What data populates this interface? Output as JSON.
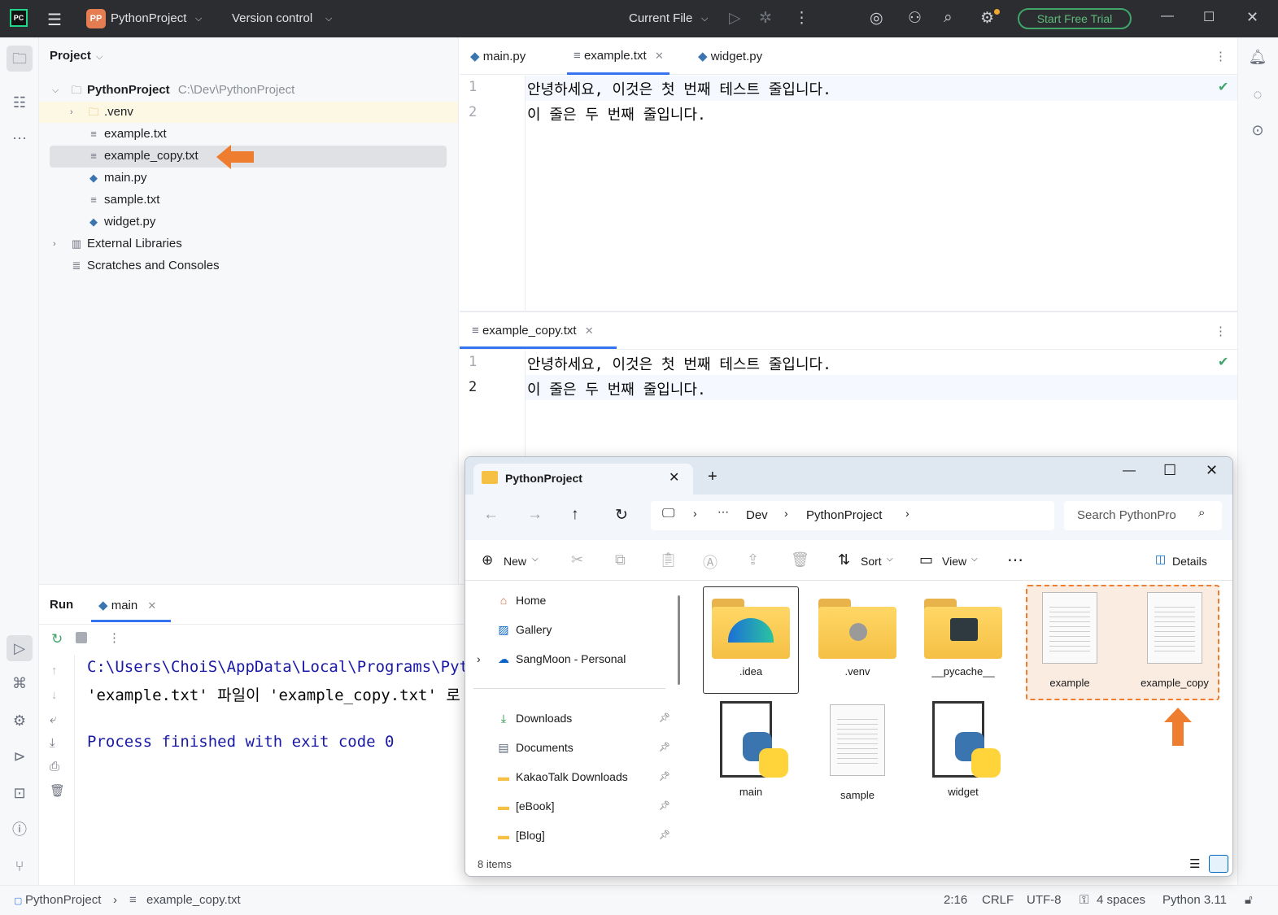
{
  "titlebar": {
    "ide_badge": "PC",
    "project_badge": "PP",
    "project_name": "PythonProject",
    "vcs": "Version control",
    "run_config": "Current File",
    "trial_button": "Start Free Trial"
  },
  "project_panel": {
    "title": "Project",
    "root_name": "PythonProject",
    "root_path": "C:\\Dev\\PythonProject",
    "items": [
      {
        "label": ".venv",
        "icon": "folder-icon"
      },
      {
        "label": "example.txt",
        "icon": "text-file-icon"
      },
      {
        "label": "example_copy.txt",
        "icon": "text-file-icon"
      },
      {
        "label": "main.py",
        "icon": "python-file-icon"
      },
      {
        "label": "sample.txt",
        "icon": "text-file-icon"
      },
      {
        "label": "widget.py",
        "icon": "python-file-icon"
      }
    ],
    "external_libraries": "External Libraries",
    "scratches": "Scratches and Consoles"
  },
  "editor_top": {
    "tabs": [
      {
        "label": "main.py"
      },
      {
        "label": "example.txt"
      },
      {
        "label": "widget.py"
      }
    ],
    "lines": [
      {
        "num": "1",
        "text": "안녕하세요, 이것은 첫 번째 테스트 줄입니다."
      },
      {
        "num": "2",
        "text": "이 줄은 두 번째 줄입니다."
      }
    ]
  },
  "editor_bottom": {
    "tab": "example_copy.txt",
    "lines": [
      {
        "num": "1",
        "text": "안녕하세요, 이것은 첫 번째 테스트 줄입니다."
      },
      {
        "num": "2",
        "text": "이 줄은 두 번째 줄입니다."
      }
    ]
  },
  "run_panel": {
    "title": "Run",
    "tab": "main",
    "output": [
      "C:\\Users\\ChoiS\\AppData\\Local\\Programs\\Pyt",
      "'example.txt' 파일이 'example_copy.txt' 로",
      "",
      "Process finished with exit code 0"
    ]
  },
  "statusbar": {
    "breadcrumb_project": "PythonProject",
    "breadcrumb_file": "example_copy.txt",
    "position": "2:16",
    "line_sep": "CRLF",
    "encoding": "UTF-8",
    "indent": "4 spaces",
    "interpreter": "Python 3.11"
  },
  "explorer": {
    "tab_title": "PythonProject",
    "path": [
      "Dev",
      "PythonProject"
    ],
    "search_placeholder": "Search PythonPro",
    "toolbar": {
      "new": "New",
      "sort": "Sort",
      "view": "View",
      "details": "Details"
    },
    "nav_top": [
      {
        "label": "Home"
      },
      {
        "label": "Gallery"
      },
      {
        "label": "SangMoon - Personal"
      }
    ],
    "nav_quick": [
      {
        "label": "Downloads"
      },
      {
        "label": "Documents"
      },
      {
        "label": "KakaoTalk Downloads"
      },
      {
        "label": "[eBook]"
      },
      {
        "label": "[Blog]"
      }
    ],
    "files": [
      {
        "name": ".idea",
        "type": "folder"
      },
      {
        "name": ".venv",
        "type": "folder"
      },
      {
        "name": "__pycache__",
        "type": "folder"
      },
      {
        "name": "example",
        "type": "text"
      },
      {
        "name": "example_copy",
        "type": "text"
      },
      {
        "name": "main",
        "type": "python"
      },
      {
        "name": "sample",
        "type": "text"
      },
      {
        "name": "widget",
        "type": "python"
      }
    ],
    "item_count": "8 items"
  },
  "colors": {
    "highlight_arrow": "#ee7d30",
    "accent_green": "#3fa56b",
    "console_blue": "#1a1aa6"
  }
}
